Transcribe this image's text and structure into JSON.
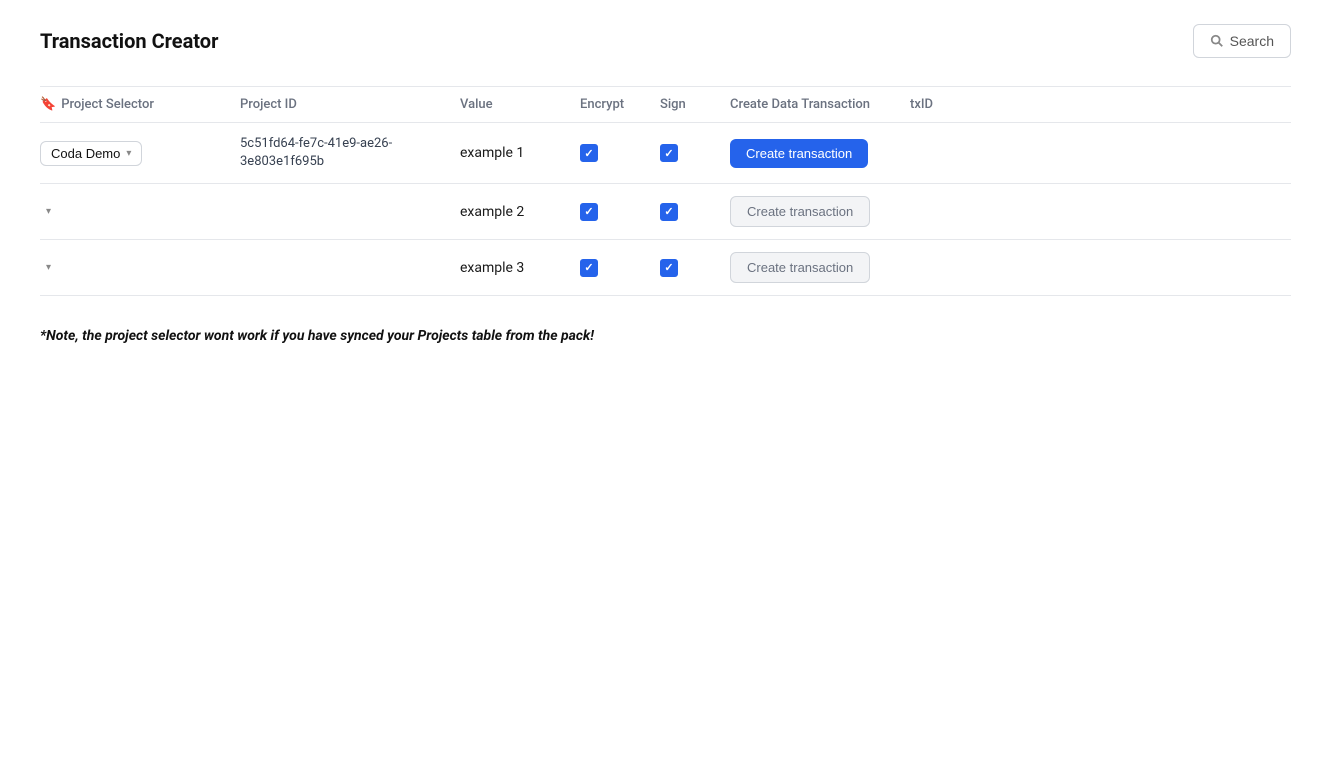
{
  "header": {
    "title": "Transaction Creator",
    "search_label": "Search"
  },
  "table": {
    "columns": [
      {
        "key": "project_selector",
        "label": "Project Selector"
      },
      {
        "key": "project_id",
        "label": "Project ID"
      },
      {
        "key": "value",
        "label": "Value"
      },
      {
        "key": "encrypt",
        "label": "Encrypt"
      },
      {
        "key": "sign",
        "label": "Sign"
      },
      {
        "key": "create_data_transaction",
        "label": "Create Data Transaction"
      },
      {
        "key": "txid",
        "label": "txID"
      }
    ],
    "rows": [
      {
        "id": "row-1",
        "project_selector": "Coda Demo",
        "has_selector": true,
        "project_id": "5c51fd64-fe7c-41e9-ae26-3e803e1f695b",
        "value": "example 1",
        "encrypt": true,
        "sign": true,
        "btn_label": "Create transaction",
        "btn_primary": true
      },
      {
        "id": "row-2",
        "project_selector": "",
        "has_selector": false,
        "project_id": "",
        "value": "example 2",
        "encrypt": true,
        "sign": true,
        "btn_label": "Create transaction",
        "btn_primary": false
      },
      {
        "id": "row-3",
        "project_selector": "",
        "has_selector": false,
        "project_id": "",
        "value": "example 3",
        "encrypt": true,
        "sign": true,
        "btn_label": "Create transaction",
        "btn_primary": false
      }
    ]
  },
  "note": "*Note, the project selector wont work if you have synced your Projects table from the pack!"
}
